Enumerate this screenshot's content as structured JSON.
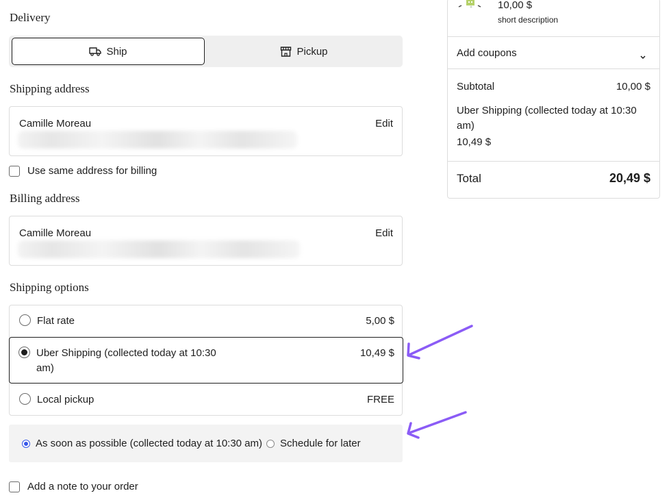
{
  "delivery": {
    "heading": "Delivery",
    "ship_label": "Ship",
    "pickup_label": "Pickup"
  },
  "shipping_address": {
    "heading": "Shipping address",
    "name": "Camille Moreau",
    "edit_label": "Edit"
  },
  "same_address_checkbox": "Use same address for billing",
  "billing_address": {
    "heading": "Billing address",
    "name": "Camille Moreau",
    "edit_label": "Edit"
  },
  "shipping_options": {
    "heading": "Shipping options",
    "items": [
      {
        "label": "Flat rate",
        "price": "5,00 $",
        "selected": false
      },
      {
        "label": "Uber Shipping (collected today at 10:30",
        "label_line2": "am)",
        "price": "10,49 $",
        "selected": true
      },
      {
        "label": "Local pickup",
        "price": "FREE",
        "selected": false
      }
    ]
  },
  "pickup_time": {
    "asap_label": "As soon as possible (collected today at 10:30 am)",
    "later_label": "Schedule for later"
  },
  "note_checkbox": "Add a note to your order",
  "summary": {
    "product_price": "10,00 $",
    "product_description": "short description",
    "coupons_label": "Add coupons",
    "subtotal_label": "Subtotal",
    "subtotal_value": "10,00 $",
    "shipping_line1": "Uber Shipping (collected today at 10:30",
    "shipping_line2": "am)",
    "shipping_value": "10,49 $",
    "total_label": "Total",
    "total_value": "20,49 $"
  },
  "colors": {
    "annotation_arrow": "#8b5cf6",
    "radio_accent": "#3858e9",
    "text": "#1e1e1e",
    "border": "#dcdcdc"
  },
  "icons": [
    "truck-icon",
    "store-icon",
    "chevron-down-icon",
    "product-thumbnail"
  ]
}
